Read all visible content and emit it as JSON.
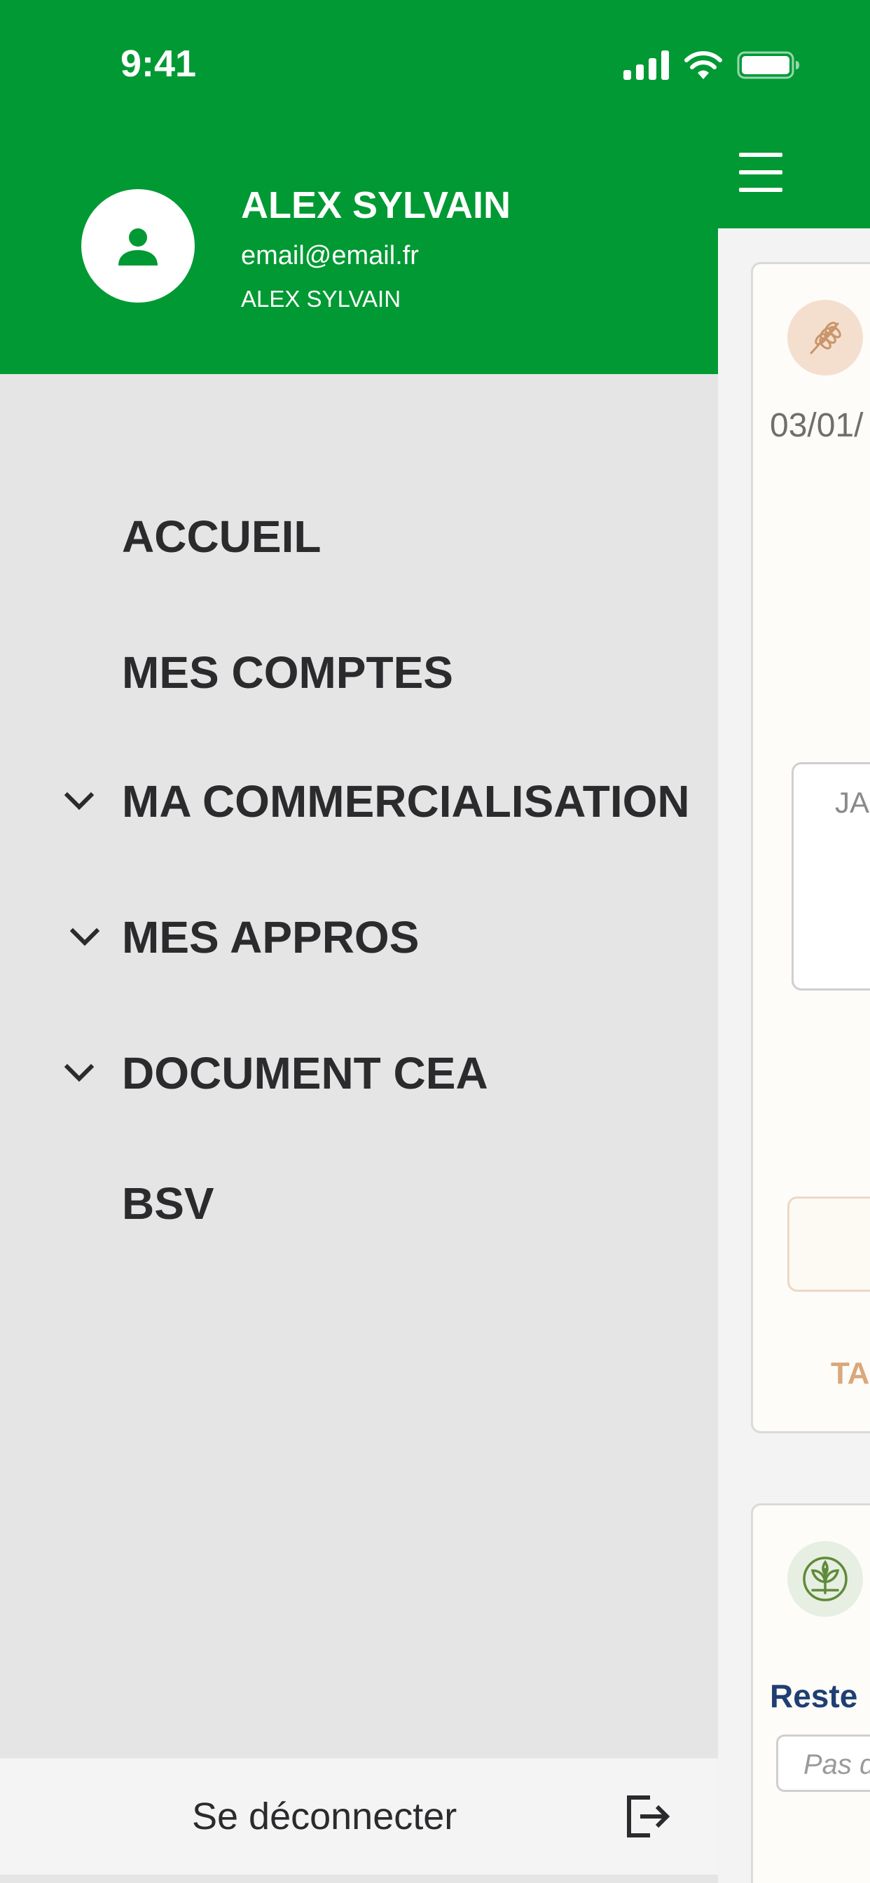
{
  "status_bar": {
    "time": "9:41"
  },
  "user": {
    "name": "ALEX SYLVAIN",
    "email": "email@email.fr",
    "subtitle": "ALEX SYLVAIN"
  },
  "menu": {
    "items": [
      {
        "label": "ACCUEIL",
        "expandable": false
      },
      {
        "label": "MES COMPTES",
        "expandable": false
      },
      {
        "label": "MA COMMERCIALISATION",
        "expandable": true
      },
      {
        "label": "MES APPROS",
        "expandable": true
      },
      {
        "label": "DOCUMENT CEA",
        "expandable": true
      },
      {
        "label": "BSV",
        "expandable": false
      }
    ],
    "logout_label": "Se déconnecter"
  },
  "background_page": {
    "card1_date": "03/01/",
    "card1_box_text": "JA",
    "card1_link": "TA",
    "card2_title": "Reste",
    "card2_input_placeholder": "Pas d"
  },
  "icons": {
    "menu": "hamburger-icon",
    "avatar": "person-icon",
    "expand": "chevron-down-icon",
    "logout": "logout-icon",
    "card1": "wheat-icon",
    "card2": "plant-icon"
  },
  "colors": {
    "brand_green": "#009933",
    "drawer_bg": "#e5e5e5",
    "menu_text": "#2b2b2e",
    "accent_tan": "#d9a87c",
    "title_navy": "#1f3f73"
  }
}
